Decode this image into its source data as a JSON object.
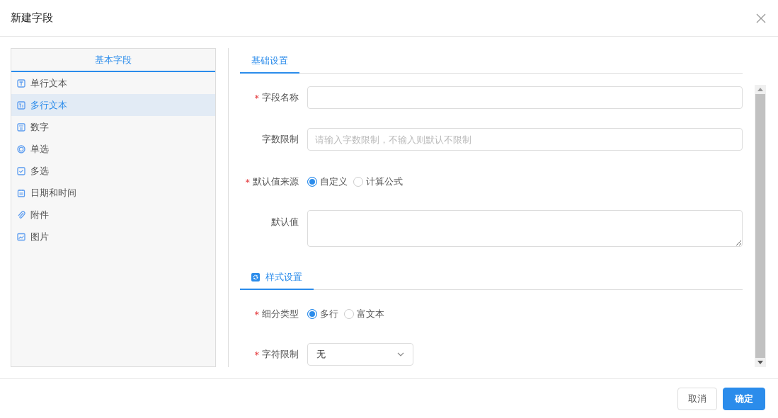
{
  "dialog": {
    "title": "新建字段"
  },
  "sidebar": {
    "title": "基本字段",
    "items": [
      {
        "label": "单行文本",
        "kind": "text",
        "selected": false
      },
      {
        "label": "多行文本",
        "kind": "textarea",
        "selected": true
      },
      {
        "label": "数字",
        "kind": "number",
        "selected": false
      },
      {
        "label": "单选",
        "kind": "radio",
        "selected": false
      },
      {
        "label": "多选",
        "kind": "checkbox",
        "selected": false
      },
      {
        "label": "日期和时间",
        "kind": "date",
        "selected": false
      },
      {
        "label": "附件",
        "kind": "attachment",
        "selected": false
      },
      {
        "label": "图片",
        "kind": "image",
        "selected": false
      }
    ]
  },
  "sections": [
    {
      "title": "基础设置",
      "icon": false,
      "fields": [
        {
          "label": "字段名称",
          "required_mark": "*",
          "kind": "input"
        },
        {
          "label": "字数限制",
          "kind": "input",
          "placeholder": "请输入字数限制，不输入则默认不限制"
        },
        {
          "label": "默认值来源",
          "required_mark": "*",
          "kind": "radio",
          "options": [
            {
              "label": "自定义",
              "selected": true
            },
            {
              "label": "计算公式",
              "selected": false
            }
          ]
        },
        {
          "label": "默认值",
          "kind": "textarea"
        }
      ]
    },
    {
      "title": "样式设置",
      "icon": true,
      "fields": [
        {
          "label": "细分类型",
          "required_mark": "*",
          "kind": "radio",
          "options": [
            {
              "label": "多行",
              "selected": true
            },
            {
              "label": "富文本",
              "selected": false
            }
          ]
        },
        {
          "label": "字符限制",
          "required_mark": "*",
          "kind": "select",
          "value": "无"
        }
      ]
    }
  ],
  "buttons": [
    {
      "label": "取消",
      "kind": "default"
    },
    {
      "label": "确定",
      "kind": "primary"
    }
  ]
}
